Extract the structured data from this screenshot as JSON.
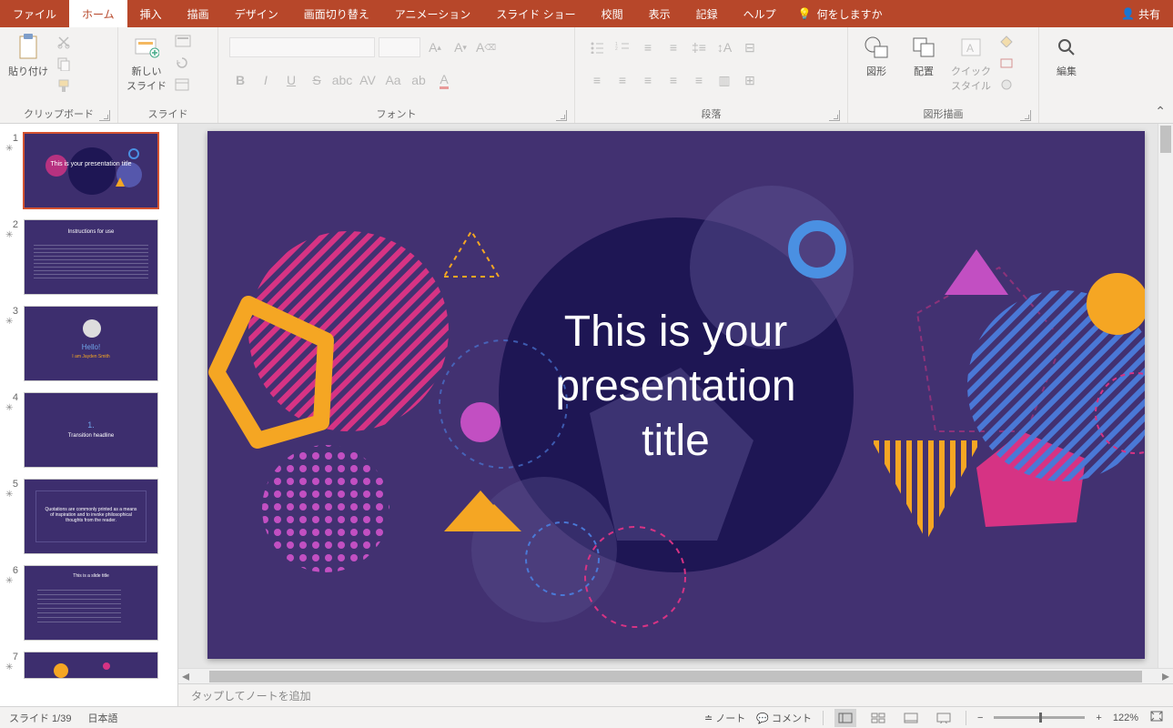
{
  "tabs": {
    "file": "ファイル",
    "home": "ホーム",
    "insert": "挿入",
    "draw": "描画",
    "design": "デザイン",
    "transitions": "画面切り替え",
    "animations": "アニメーション",
    "slideshow": "スライド ショー",
    "review": "校閲",
    "view": "表示",
    "record": "記録",
    "help": "ヘルプ",
    "tellme": "何をしますか"
  },
  "share": "共有",
  "ribbon": {
    "clipboard": {
      "label": "クリップボード",
      "paste": "貼り付け"
    },
    "slides": {
      "label": "スライド",
      "new": "新しい\nスライド"
    },
    "font": {
      "label": "フォント"
    },
    "paragraph": {
      "label": "段落"
    },
    "drawing": {
      "label": "図形描画",
      "shapes": "図形",
      "arrange": "配置",
      "quickstyle": "クイック\nスタイル"
    },
    "editing": {
      "label": "編集"
    }
  },
  "slide": {
    "title": "This is your\npresentation\ntitle"
  },
  "thumbnails": [
    {
      "n": "1",
      "text": "This is your presentation title"
    },
    {
      "n": "2",
      "text": "Instructions for use"
    },
    {
      "n": "3",
      "text": "Hello!",
      "sub": "I am Jayden Smith"
    },
    {
      "n": "4",
      "text": "1.",
      "sub": "Transition headline"
    },
    {
      "n": "5",
      "text": "Quotations are commonly printed as a means of inspiration and to invoke philosophical thoughts from the reader."
    },
    {
      "n": "6",
      "text": "This is a slide title"
    },
    {
      "n": "7",
      "text": ""
    }
  ],
  "notes": "タップしてノートを追加",
  "status": {
    "slide": "スライド 1/39",
    "lang": "日本語",
    "notes": "ノート",
    "comments": "コメント",
    "zoom": "122%"
  }
}
